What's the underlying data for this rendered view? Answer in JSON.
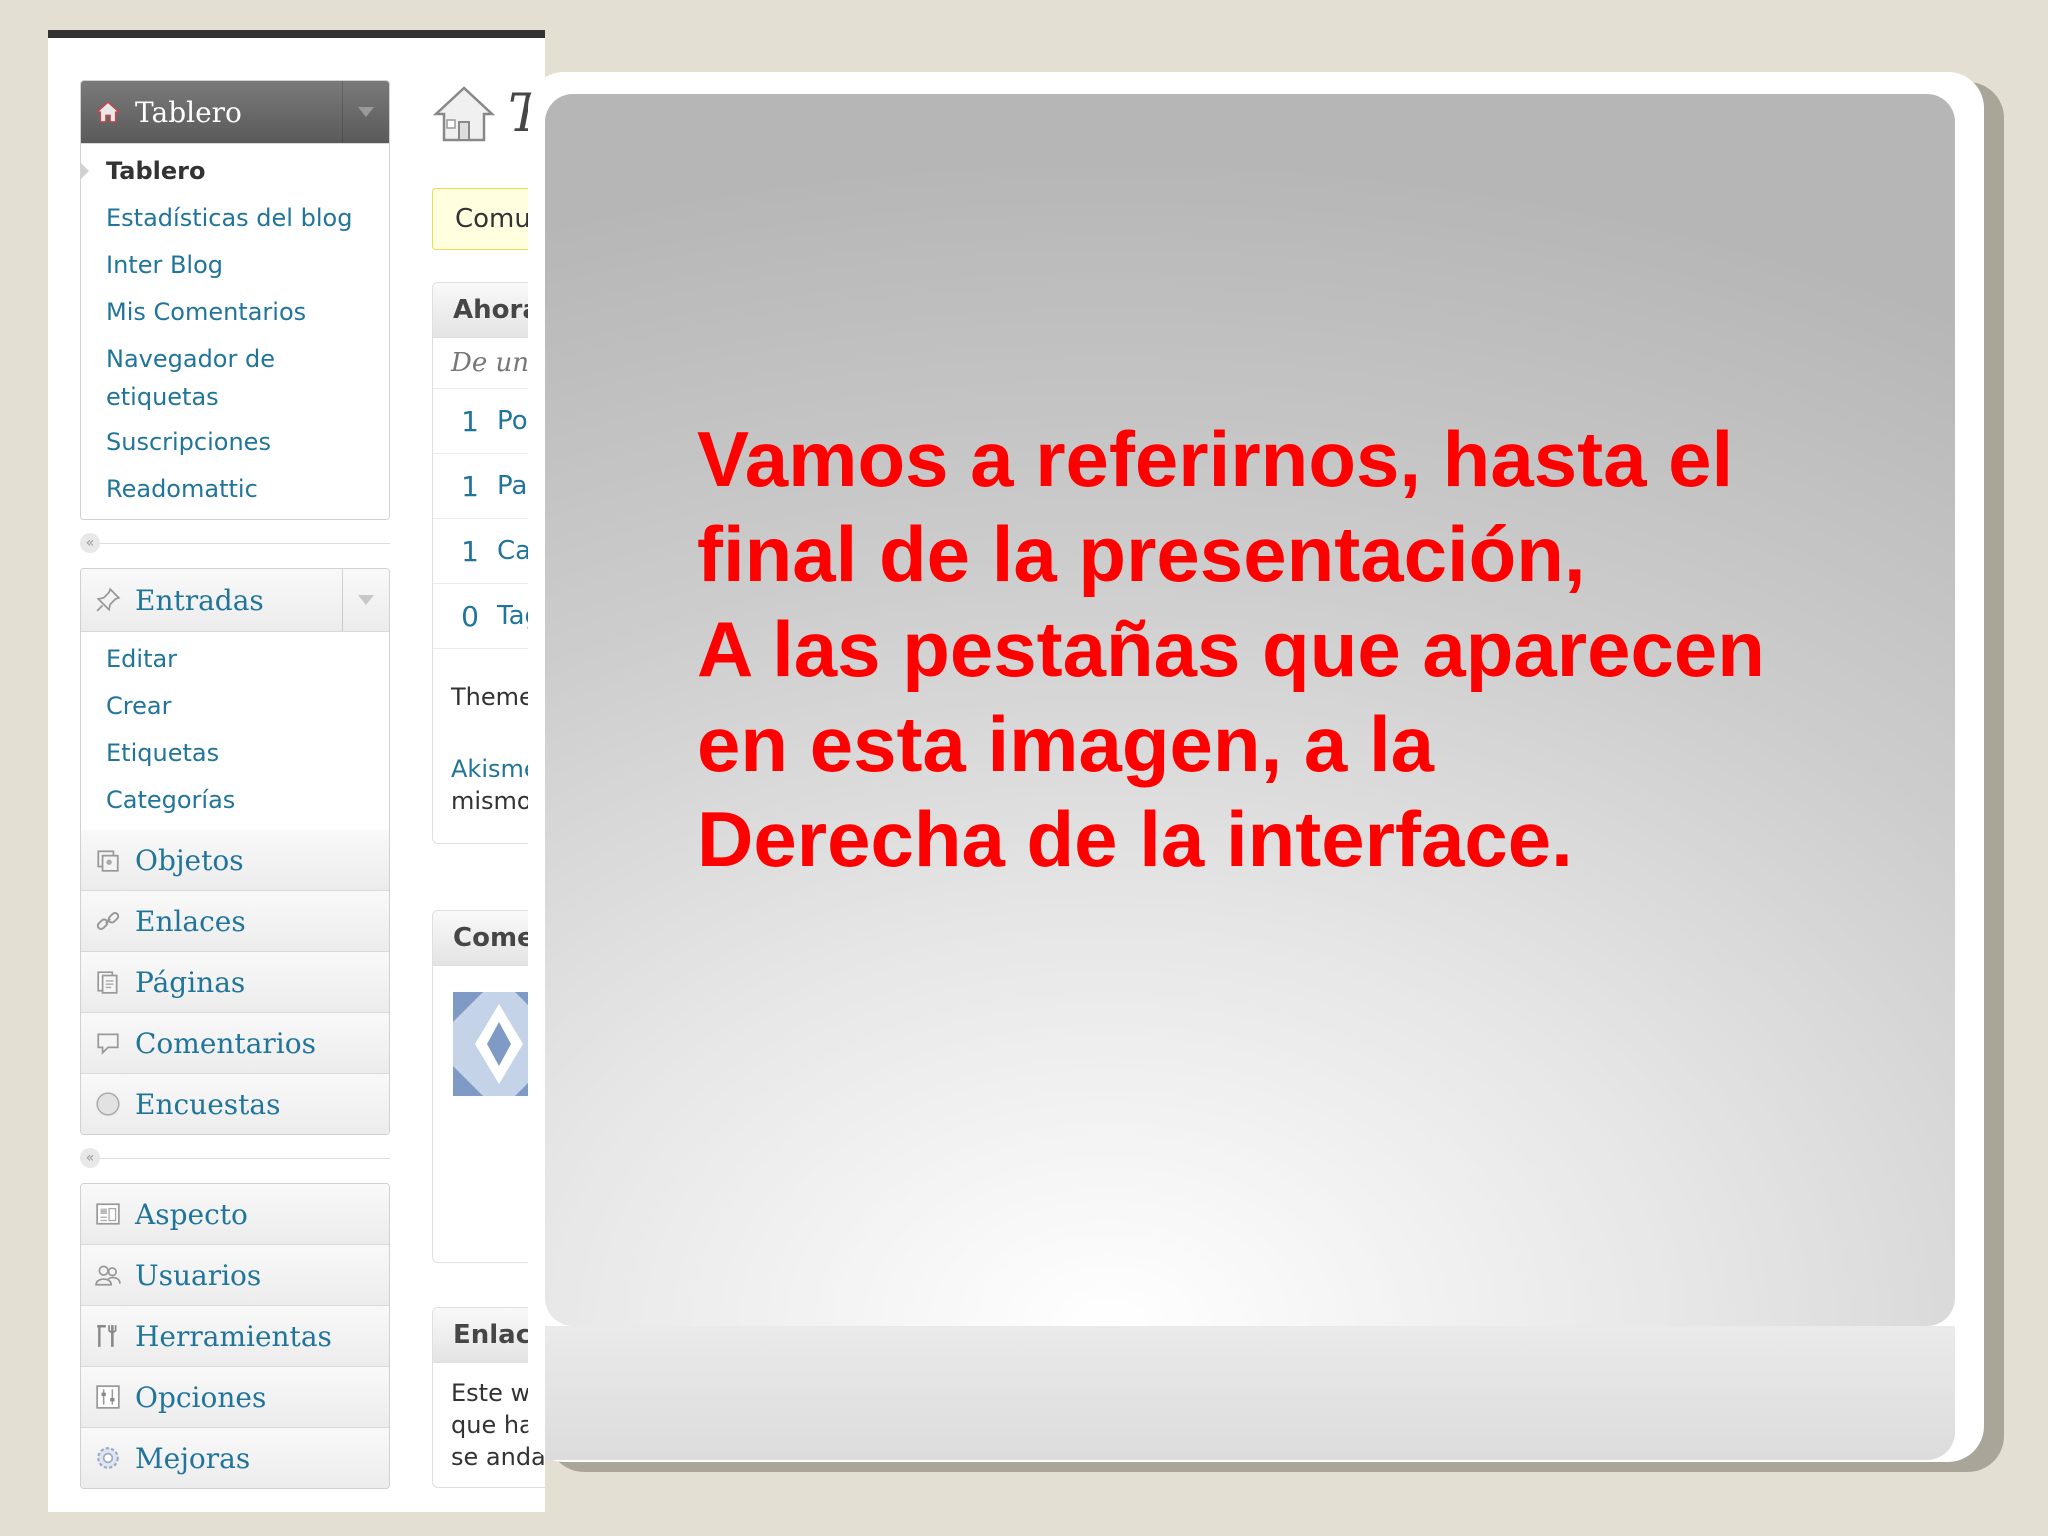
{
  "sidebar": {
    "dashboard": {
      "label": "Tablero",
      "items": [
        "Tablero",
        "Estadísticas del blog",
        "Inter Blog",
        "Mis Comentarios",
        "Navegador de",
        "etiquetas",
        "Suscripciones",
        "Readomattic"
      ]
    },
    "posts": {
      "label": "Entradas",
      "items": [
        "Editar",
        "Crear",
        "Etiquetas",
        "Categorías"
      ]
    },
    "menu_group_1": [
      "Objetos",
      "Enlaces",
      "Páginas",
      "Comentarios",
      "Encuestas"
    ],
    "menu_group_2": [
      "Aspecto",
      "Usuarios",
      "Herramientas",
      "Opciones",
      "Mejoras"
    ],
    "collapse_glyph": "«"
  },
  "main": {
    "title": "T",
    "notice": "Comun",
    "right_now": {
      "header": "Ahora",
      "sub": "De un u",
      "rows": [
        {
          "n": "1",
          "label": "Pos"
        },
        {
          "n": "1",
          "label": "Pag"
        },
        {
          "n": "1",
          "label": "Cat"
        },
        {
          "n": "0",
          "label": "Tag"
        }
      ],
      "theme": "Theme",
      "akismet_1": "Akisme",
      "akismet_2": "mismo"
    },
    "comments": {
      "header": "Comen"
    },
    "links": {
      "header": "Enlace",
      "line1": "Este wi",
      "line2": "que hay",
      "line3": "se anda"
    }
  },
  "slide": {
    "lines": [
      "Vamos a referirnos, hasta el",
      "final de la presentación,",
      "A las pestañas que aparecen",
      "en esta imagen, a la",
      "Derecha de la interface."
    ]
  },
  "colors": {
    "slide_text": "#ff0000",
    "wp_link": "#21759b",
    "background": "#e3dfd3"
  }
}
